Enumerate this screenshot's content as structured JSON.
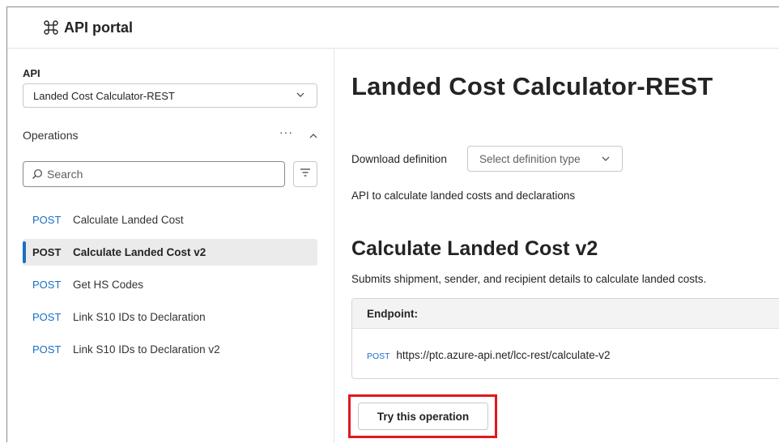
{
  "header": {
    "title": "API portal",
    "logo_icon": "command-icon"
  },
  "sidebar": {
    "api_label": "API",
    "api_selected": "Landed Cost Calculator-REST",
    "operations_label": "Operations",
    "more_label": "···",
    "search_placeholder": "Search",
    "operations": [
      {
        "method": "POST",
        "name": "Calculate Landed Cost",
        "selected": false
      },
      {
        "method": "POST",
        "name": "Calculate Landed Cost v2",
        "selected": true
      },
      {
        "method": "POST",
        "name": "Get HS Codes",
        "selected": false
      },
      {
        "method": "POST",
        "name": "Link S10 IDs to Declaration",
        "selected": false
      },
      {
        "method": "POST",
        "name": "Link S10 IDs to Declaration v2",
        "selected": false
      }
    ]
  },
  "main": {
    "title": "Landed Cost Calculator-REST",
    "download_label": "Download definition",
    "download_placeholder": "Select definition type",
    "api_description": "API to calculate landed costs and declarations",
    "operation_title": "Calculate Landed Cost v2",
    "operation_description": "Submits shipment, sender, and recipient details to calculate landed costs.",
    "endpoint_label": "Endpoint:",
    "endpoint_method": "POST",
    "endpoint_url": "https://ptc.azure-api.net/lcc-rest/calculate-v2",
    "try_button": "Try this operation"
  },
  "colors": {
    "accent": "#1a6fc4",
    "highlight": "#e0191f",
    "selected_bg": "#ebebeb"
  }
}
